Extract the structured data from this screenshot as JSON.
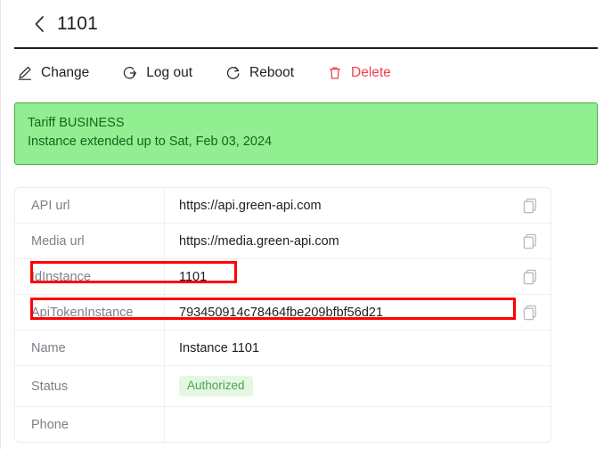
{
  "header": {
    "back_icon": "chevron-left-icon",
    "title": "1101"
  },
  "toolbar": {
    "items": [
      {
        "label": "Change",
        "icon": "pencil-edit-icon",
        "danger": false
      },
      {
        "label": "Log out",
        "icon": "logout-icon",
        "danger": false
      },
      {
        "label": "Reboot",
        "icon": "refresh-icon",
        "danger": false
      },
      {
        "label": "Delete",
        "icon": "trash-icon",
        "danger": true
      }
    ],
    "danger_color": "#f1414b"
  },
  "banner": {
    "tariff_line": "Tariff BUSINESS",
    "expiry_line": "Instance extended up to Sat, Feb 03, 2024",
    "bg_color": "#91ef91",
    "border_color": "#3fae3f",
    "text_color": "#14661a"
  },
  "details_table": {
    "copy_icon": "copy-icon",
    "rows": [
      {
        "label": "API url",
        "value": "https://api.green-api.com",
        "copy": true,
        "highlight": false,
        "badge": false
      },
      {
        "label": "Media url",
        "value": "https://media.green-api.com",
        "copy": true,
        "highlight": false,
        "badge": false
      },
      {
        "label": "IdInstance",
        "value": "1101",
        "copy": true,
        "highlight": "id",
        "badge": false
      },
      {
        "label": "ApiTokenInstance",
        "value": "793450914c78464fbe209bfbf56d21",
        "copy": true,
        "highlight": "token",
        "badge": false
      },
      {
        "label": "Name",
        "value": "Instance 1101",
        "copy": false,
        "highlight": false,
        "badge": false
      },
      {
        "label": "Status",
        "value": "Authorized",
        "copy": false,
        "highlight": false,
        "badge": true
      },
      {
        "label": "Phone",
        "value": "",
        "copy": false,
        "highlight": false,
        "badge": false
      }
    ]
  },
  "annotation": {
    "color": "#fe0000"
  }
}
